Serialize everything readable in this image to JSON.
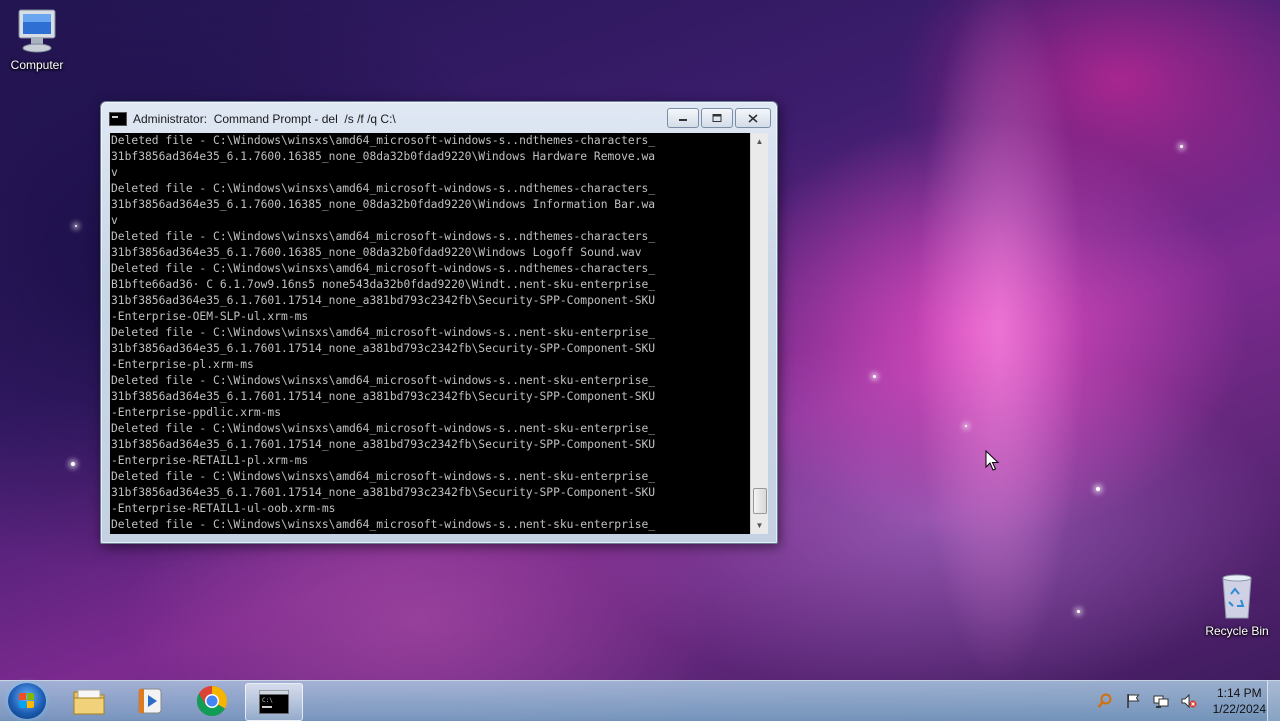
{
  "desktop": {
    "icons": [
      {
        "label": "Computer",
        "icon": "computer-icon"
      },
      {
        "label": "Recycle Bin",
        "icon": "recycle-bin-icon"
      }
    ]
  },
  "window": {
    "title": "Administrator:  Command Prompt - del  /s /f /q C:\\",
    "controls": {
      "minimize": "minimize-icon",
      "maximize": "maximize-icon",
      "close": "close-icon"
    },
    "console_lines": [
      "Deleted file - C:\\Windows\\winsxs\\amd64_microsoft-windows-s..ndthemes-characters_",
      "31bf3856ad364e35_6.1.7600.16385_none_08da32b0fdad9220\\Windows Hardware Remove.wa",
      "v",
      "Deleted file - C:\\Windows\\winsxs\\amd64_microsoft-windows-s..ndthemes-characters_",
      "31bf3856ad364e35_6.1.7600.16385_none_08da32b0fdad9220\\Windows Information Bar.wa",
      "v",
      "Deleted file - C:\\Windows\\winsxs\\amd64_microsoft-windows-s..ndthemes-characters_",
      "31bf3856ad364e35_6.1.7600.16385_none_08da32b0fdad9220\\Windows Logoff Sound.wav",
      "Deleted file - C:\\Windows\\winsxs\\amd64_microsoft-windows-s..ndthemes-characters_",
      "B1bfte66ad36· C 6.1.7ow9.16ns5 none54̄3da32b0fdad9220\\Windt..nent-sku-enterprise_",
      "31bf3856ad364e35_6.1.7601.17514_none_a381bd793c2342fb\\Security-SPP-Component-SKU",
      "-Enterprise-OEM-SLP-ul.xrm-ms",
      "Deleted file - C:\\Windows\\winsxs\\amd64_microsoft-windows-s..nent-sku-enterprise_",
      "31bf3856ad364e35_6.1.7601.17514_none_a381bd793c2342fb\\Security-SPP-Component-SKU",
      "-Enterprise-pl.xrm-ms",
      "Deleted file - C:\\Windows\\winsxs\\amd64_microsoft-windows-s..nent-sku-enterprise_",
      "31bf3856ad364e35_6.1.7601.17514_none_a381bd793c2342fb\\Security-SPP-Component-SKU",
      "-Enterprise-ppdlic.xrm-ms",
      "Deleted file - C:\\Windows\\winsxs\\amd64_microsoft-windows-s..nent-sku-enterprise_",
      "31bf3856ad364e35_6.1.7601.17514_none_a381bd793c2342fb\\Security-SPP-Component-SKU",
      "-Enterprise-RETAIL1-pl.xrm-ms",
      "Deleted file - C:\\Windows\\winsxs\\amd64_microsoft-windows-s..nent-sku-enterprise_",
      "31bf3856ad364e35_6.1.7601.17514_none_a381bd793c2342fb\\Security-SPP-Component-SKU",
      "-Enterprise-RETAIL1-ul-oob.xrm-ms",
      "Deleted file - C:\\Windows\\winsxs\\amd64_microsoft-windows-s..nent-sku-enterprise_"
    ]
  },
  "taskbar": {
    "start_icon": "windows-start-icon",
    "pinned": [
      {
        "icon": "file-explorer-icon",
        "active": false
      },
      {
        "icon": "media-player-icon",
        "active": false
      },
      {
        "icon": "chrome-icon",
        "active": false
      },
      {
        "icon": "command-prompt-icon",
        "active": true
      }
    ],
    "tray_icons": [
      "search-tray-icon",
      "action-center-flag-icon",
      "network-icon",
      "volume-muted-icon"
    ],
    "clock": {
      "time": "1:14 PM",
      "date": "1/22/2024"
    }
  }
}
